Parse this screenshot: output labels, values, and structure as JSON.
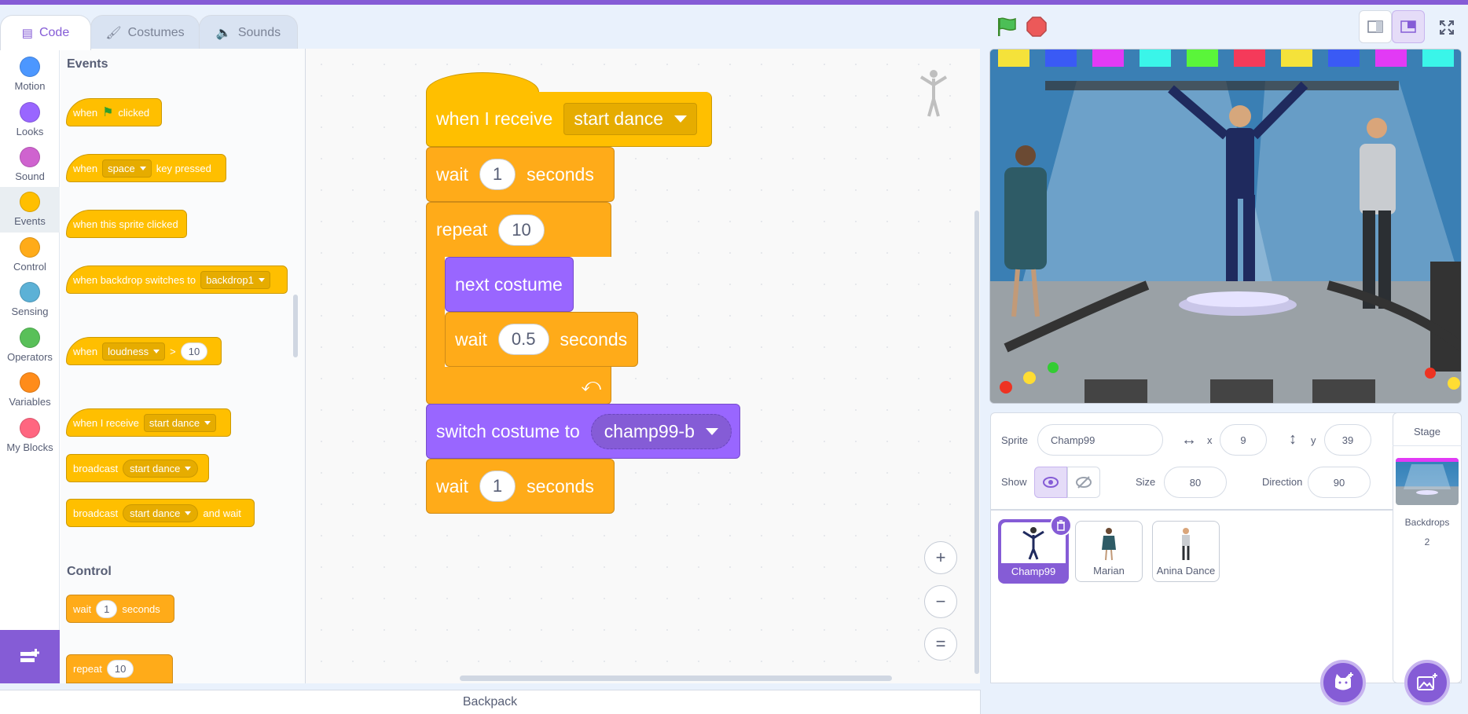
{
  "tabs": [
    {
      "label": "Code"
    },
    {
      "label": "Costumes"
    },
    {
      "label": "Sounds"
    }
  ],
  "categories": [
    {
      "label": "Motion",
      "color": "#4c97ff"
    },
    {
      "label": "Looks",
      "color": "#9966ff"
    },
    {
      "label": "Sound",
      "color": "#cf63cf"
    },
    {
      "label": "Events",
      "color": "#ffbf00"
    },
    {
      "label": "Control",
      "color": "#ffab19"
    },
    {
      "label": "Sensing",
      "color": "#5cb1d6"
    },
    {
      "label": "Operators",
      "color": "#59c059"
    },
    {
      "label": "Variables",
      "color": "#ff8c1a"
    },
    {
      "label": "My Blocks",
      "color": "#ff6680"
    }
  ],
  "palette": {
    "events_title": "Events",
    "control_title": "Control",
    "b1": {
      "when": "when",
      "clicked": "clicked"
    },
    "b2": {
      "when": "when",
      "key": "space",
      "pressed": "key pressed"
    },
    "b3": {
      "text": "when this sprite clicked"
    },
    "b4": {
      "text": "when backdrop switches to",
      "value": "backdrop1"
    },
    "b5": {
      "when": "when",
      "value": "loudness",
      "op": ">",
      "num": "10"
    },
    "b6": {
      "text": "when I receive",
      "value": "start dance"
    },
    "b7": {
      "text": "broadcast",
      "value": "start dance"
    },
    "b8": {
      "text": "broadcast",
      "value": "start dance",
      "tail": "and wait"
    },
    "b9": {
      "text": "wait",
      "num": "1",
      "tail": "seconds"
    },
    "b10": {
      "text": "repeat",
      "num": "10"
    }
  },
  "script": {
    "hat": {
      "text": "when I receive",
      "value": "start dance"
    },
    "wait1": {
      "text": "wait",
      "num": "1",
      "tail": "seconds"
    },
    "repeat": {
      "text": "repeat",
      "num": "10"
    },
    "next_costume": {
      "text": "next costume"
    },
    "wait2": {
      "text": "wait",
      "num": "0.5",
      "tail": "seconds"
    },
    "switch": {
      "text": "switch costume to",
      "value": "champ99-b"
    },
    "wait3": {
      "text": "wait",
      "num": "1",
      "tail": "seconds"
    }
  },
  "zoom": {
    "in": "+",
    "out": "−",
    "reset": "="
  },
  "backpack": {
    "label": "Backpack"
  },
  "sprite_info": {
    "sprite_label": "Sprite",
    "sprite_name": "Champ99",
    "x_label": "x",
    "x": "9",
    "y_label": "y",
    "y": "39",
    "show_label": "Show",
    "size_label": "Size",
    "size": "80",
    "direction_label": "Direction",
    "direction": "90"
  },
  "sprites": [
    {
      "name": "Champ99"
    },
    {
      "name": "Marian"
    },
    {
      "name": "Anina Dance"
    }
  ],
  "stage_panel": {
    "title": "Stage",
    "backdrops_label": "Backdrops",
    "backdrops_count": "2"
  },
  "colors": {
    "accent": "#855cd6",
    "events": "#ffbf00",
    "control": "#ffab19",
    "looks": "#9966ff"
  }
}
